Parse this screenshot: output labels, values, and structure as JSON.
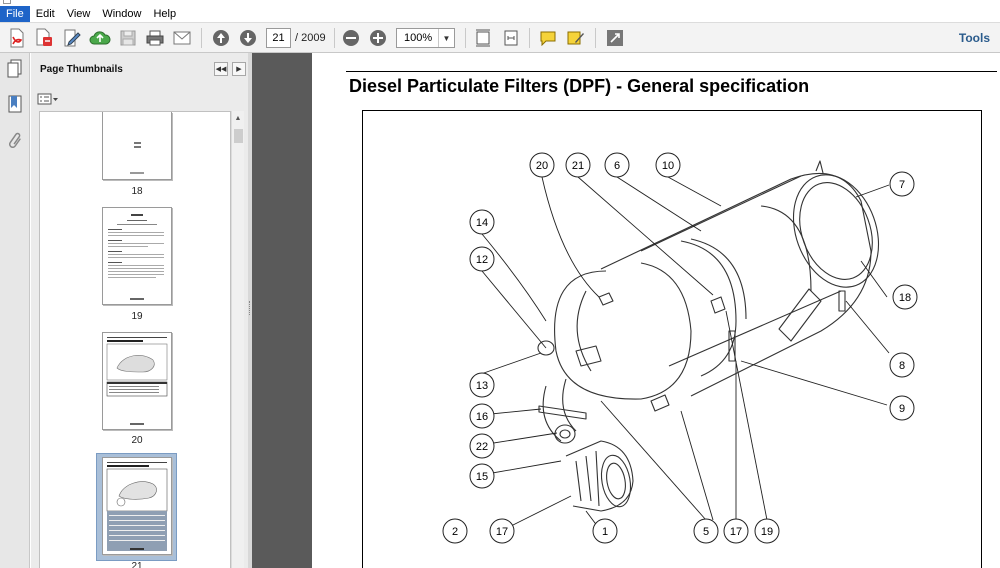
{
  "menu": [
    "File",
    "Edit",
    "View",
    "Window",
    "Help"
  ],
  "toolbar": {
    "page_current": "21",
    "page_total": "/ 2009",
    "zoom_value": "100%",
    "tools_label": "Tools",
    "icons": [
      "create-pdf-icon",
      "convert-icon",
      "edit-icon",
      "cloud-upload-icon",
      "save-icon",
      "print-icon",
      "email-icon",
      "previous-page-icon",
      "next-page-icon",
      "zoom-out-icon",
      "zoom-in-icon",
      "fit-page-icon",
      "fit-width-icon",
      "comment-icon",
      "highlight-icon",
      "full-screen-icon"
    ]
  },
  "nav_rail": {
    "icons": [
      "page-thumbnails-icon",
      "bookmarks-icon",
      "attachments-icon"
    ]
  },
  "thumbnails": {
    "title": "Page Thumbnails",
    "pages": [
      {
        "number": "18"
      },
      {
        "number": "19"
      },
      {
        "number": "20"
      },
      {
        "number": "21",
        "selected": true
      }
    ]
  },
  "document": {
    "heading": "Diesel Particulate Filters (DPF) - General specification",
    "callouts": [
      "20",
      "21",
      "6",
      "10",
      "7",
      "14",
      "12",
      "18",
      "8",
      "13",
      "9",
      "16",
      "22",
      "15",
      "2",
      "17",
      "1",
      "5",
      "17",
      "19"
    ]
  }
}
